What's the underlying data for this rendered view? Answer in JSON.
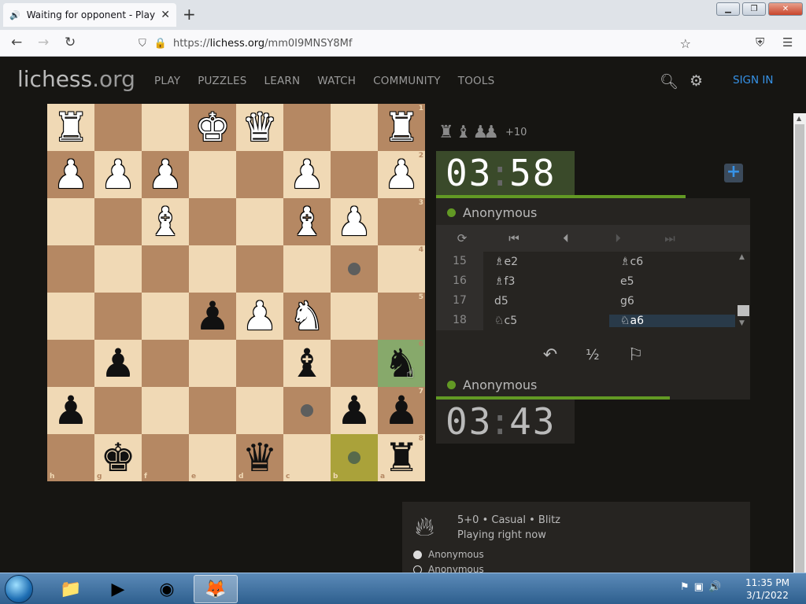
{
  "browser": {
    "tab_title": "Waiting for opponent - Play An",
    "url_scheme": "https://",
    "url_host": "lichess.org",
    "url_path": "/mm0I9MNSY8Mf"
  },
  "site": {
    "logo_main": "lichess",
    "logo_tld": ".org",
    "nav": [
      "PLAY",
      "PUZZLES",
      "LEARN",
      "WATCH",
      "COMMUNITY",
      "TOOLS"
    ],
    "signin": "SIGN IN"
  },
  "board": {
    "orientation": "black",
    "ranks": [
      [
        [
          "wR"
        ],
        [
          "light"
        ],
        [
          "light"
        ],
        [
          "wK"
        ],
        [
          "wQ"
        ],
        [
          ""
        ],
        [
          ""
        ],
        [
          "wR"
        ]
      ],
      [
        [
          "wP"
        ],
        [
          "wP"
        ],
        [
          "wP"
        ],
        [
          ""
        ],
        [
          ""
        ],
        [
          "wP"
        ],
        [
          ""
        ],
        [
          "wP"
        ]
      ]
    ],
    "squares": [
      [
        "wR",
        "",
        "",
        "wK",
        "wQ",
        "",
        "",
        "wR"
      ],
      [
        "wP",
        "wP",
        "wP",
        "",
        "",
        "wP",
        "",
        "wP"
      ],
      [
        "",
        "",
        "wB",
        "",
        "",
        "wB",
        "wP",
        ""
      ],
      [
        "",
        "",
        "",
        "",
        "",
        "",
        "dot",
        ""
      ],
      [
        "",
        "",
        "",
        "bP",
        "wP",
        "wN",
        "",
        ""
      ],
      [
        "",
        "bP",
        "",
        "",
        "",
        "bB",
        "",
        "bN"
      ],
      [
        "bP",
        "",
        "",
        "",
        "",
        "dot",
        "bP",
        "bP"
      ],
      [
        "",
        "bK",
        "",
        "",
        "bQ",
        "",
        "dot",
        "bR"
      ]
    ],
    "rank_labels": [
      "1",
      "2",
      "3",
      "4",
      "5",
      "6",
      "7",
      "8"
    ],
    "file_labels": [
      "h",
      "g",
      "f",
      "e",
      "d",
      "c",
      "b",
      "a"
    ],
    "highlight": {
      "dark_square": [
        7,
        6
      ],
      "selected_square": [
        5,
        7
      ]
    }
  },
  "panel": {
    "material_captured": [
      "rook",
      "bishop",
      "pawn",
      "pawn"
    ],
    "material_diff": "+10",
    "top_clock": {
      "min": "03",
      "sec": "58"
    },
    "top_player": "Anonymous",
    "bottom_player": "Anonymous",
    "bottom_clock": {
      "min": "03",
      "sec": "43"
    },
    "moves": [
      {
        "num": "15",
        "white": "♗e2",
        "black": "♗c6"
      },
      {
        "num": "16",
        "white": "♗f3",
        "black": "e5"
      },
      {
        "num": "17",
        "white": "d5",
        "black": "g6"
      },
      {
        "num": "18",
        "white": "♘c5",
        "black": "♘a6",
        "selected": "black"
      }
    ],
    "draw_label": "½"
  },
  "game_info": {
    "line1": "5+0 • Casual • Blitz",
    "line2": "Playing right now",
    "white_player": "Anonymous",
    "black_player": "Anonymous"
  },
  "taskbar": {
    "time": "11:35 PM",
    "date": "3/1/2022"
  }
}
